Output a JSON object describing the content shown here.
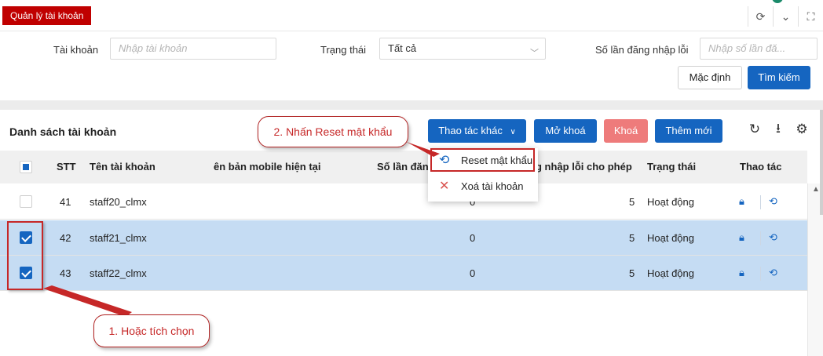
{
  "app": {
    "title": "Quản lý tài khoản"
  },
  "filters": {
    "account_label": "Tài khoản",
    "account_placeholder": "Nhập tài khoản",
    "status_label": "Trạng thái",
    "status_value": "Tất cả",
    "fail_count_label": "Số lần đăng nhập lỗi",
    "fail_count_placeholder": "Nhập số lần đă...",
    "reset_button": "Mặc định",
    "search_button": "Tìm kiếm"
  },
  "list": {
    "title": "Danh sách tài khoản",
    "actions": {
      "more": "Thao tác khác",
      "unlock": "Mở khoá",
      "lock": "Khoá",
      "add": "Thêm mới"
    },
    "columns": {
      "stt": "STT",
      "username": "Tên tài khoản",
      "mobile": "ên bản mobile hiện tại",
      "fail_count": "Số lần đăn",
      "allowed": "g nhập lỗi cho phép",
      "status": "Trạng thái",
      "actions": "Thao tác"
    },
    "rows": [
      {
        "stt": "41",
        "username": "staff20_clmx",
        "fail_count": "0",
        "allowed": "5",
        "status": "Hoạt động",
        "checked": false
      },
      {
        "stt": "42",
        "username": "staff21_clmx",
        "fail_count": "0",
        "allowed": "5",
        "status": "Hoạt động",
        "checked": true
      },
      {
        "stt": "43",
        "username": "staff22_clmx",
        "fail_count": "0",
        "allowed": "5",
        "status": "Hoạt động",
        "checked": true
      }
    ]
  },
  "dropdown": {
    "items": [
      {
        "label": "Reset mật khẩu",
        "icon": "lock-reset-icon"
      },
      {
        "label": "Xoá tài khoản",
        "icon": "close-x-icon"
      }
    ]
  },
  "annotations": {
    "step2": "2. Nhấn Reset mật khẩu",
    "step1": "1. Hoặc tích chọn"
  },
  "colors": {
    "brand_red": "#c00000",
    "primary": "#1565c0",
    "danger": "#ee7b7b",
    "selected_row": "#c5dcf3",
    "annotation": "#c62828"
  }
}
